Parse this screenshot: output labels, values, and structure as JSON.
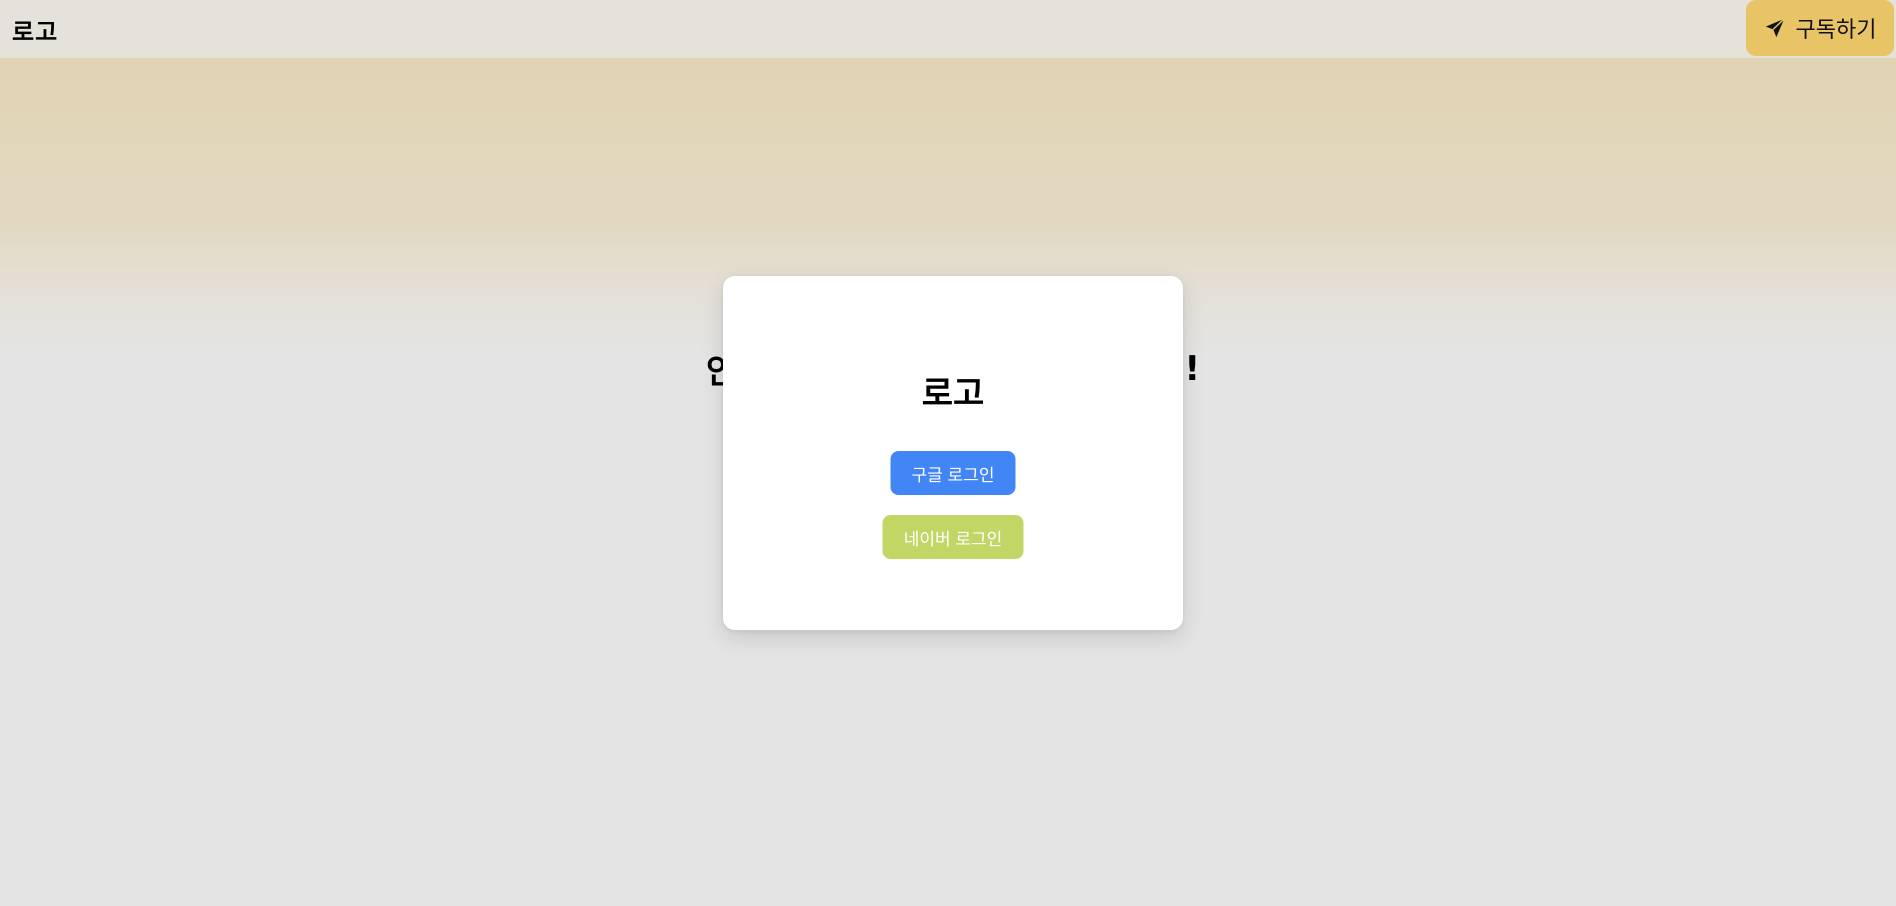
{
  "header": {
    "logo": "로고",
    "subscribe_label": "구독하기",
    "subscribe_icon": "send-icon"
  },
  "hero": {
    "text_start": "안",
    "text_end": "!"
  },
  "modal": {
    "title": "로고",
    "google_label": "구글 로그인",
    "naver_label": "네이버 로그인"
  },
  "colors": {
    "google": "#4285f4",
    "naver": "#c2d665",
    "subscribe": "#e8c466",
    "header": "#e5e2dc"
  }
}
